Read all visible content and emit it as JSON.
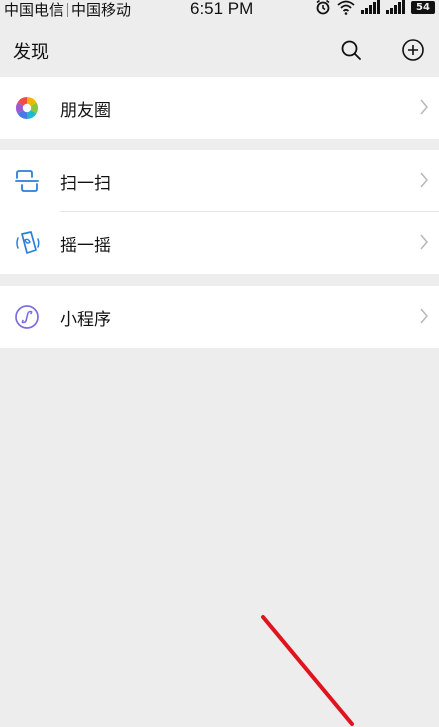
{
  "status_bar": {
    "carrier_1": "中国电信",
    "carrier_2": "中国移动",
    "time": "6:51 PM",
    "battery": "54"
  },
  "header": {
    "title": "发现",
    "icons": {
      "search": "search-icon",
      "add": "plus-circle-icon"
    }
  },
  "groups": [
    {
      "items": [
        {
          "label": "朋友圈",
          "icon": "moments-icon"
        }
      ]
    },
    {
      "items": [
        {
          "label": "扫一扫",
          "icon": "scan-icon"
        },
        {
          "label": "摇一摇",
          "icon": "shake-icon"
        }
      ]
    },
    {
      "items": [
        {
          "label": "小程序",
          "icon": "mini-program-icon"
        }
      ]
    }
  ],
  "colors": {
    "background": "#ededed",
    "scan_blue": "#2c7fd8",
    "mini_program_purple": "#7b6fe0",
    "annotation_red": "#e0141e"
  }
}
